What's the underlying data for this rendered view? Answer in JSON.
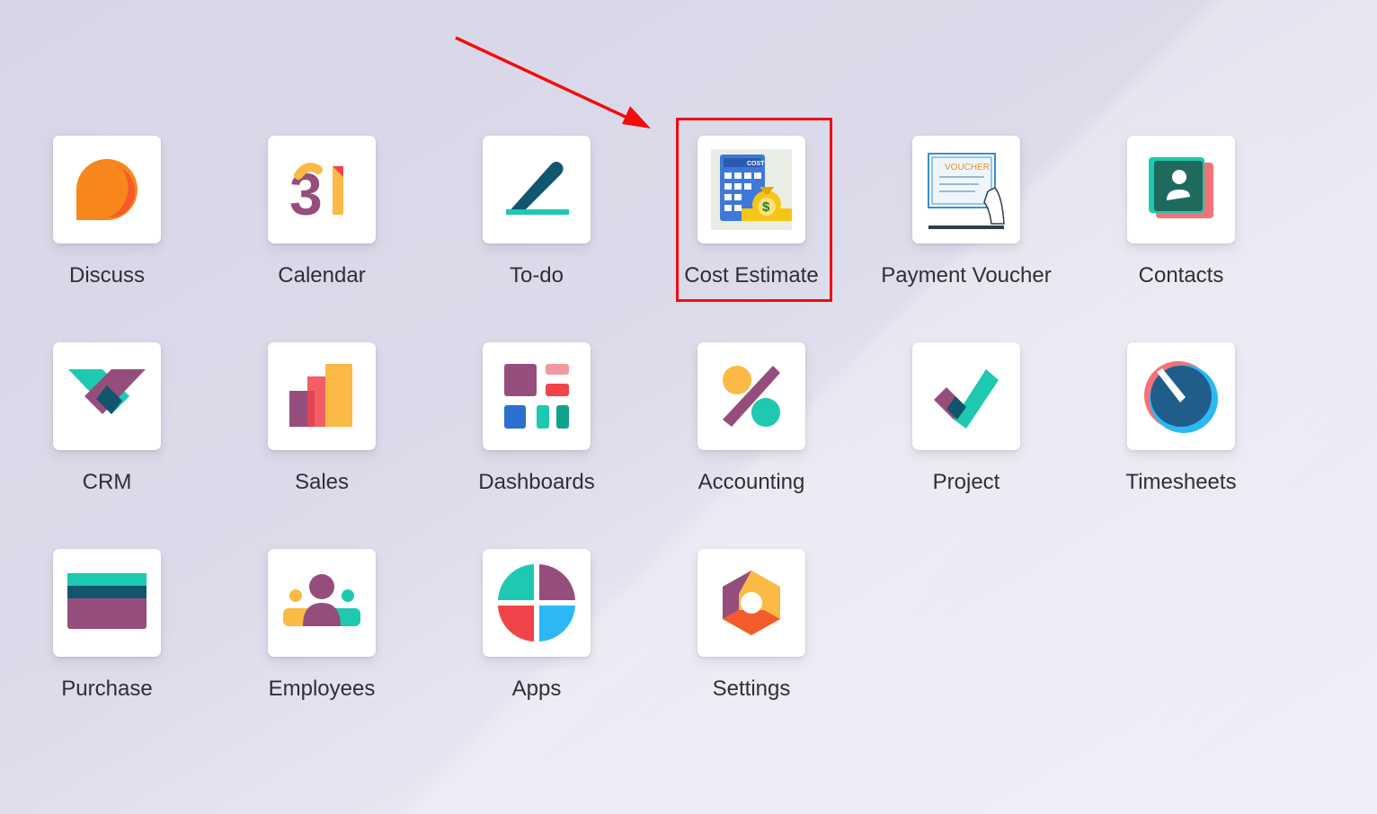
{
  "apps": [
    {
      "label": "Discuss",
      "icon": "discuss-icon"
    },
    {
      "label": "Calendar",
      "icon": "calendar-icon",
      "icon_text": "31"
    },
    {
      "label": "To-do",
      "icon": "todo-icon"
    },
    {
      "label": "Cost Estimate",
      "icon": "cost-estimate-icon",
      "icon_text": "COST"
    },
    {
      "label": "Payment Voucher",
      "icon": "payment-voucher-icon",
      "icon_text": "VOUCHER"
    },
    {
      "label": "Contacts",
      "icon": "contacts-icon"
    },
    {
      "label": "CRM",
      "icon": "crm-icon"
    },
    {
      "label": "Sales",
      "icon": "sales-icon"
    },
    {
      "label": "Dashboards",
      "icon": "dashboards-icon"
    },
    {
      "label": "Accounting",
      "icon": "accounting-icon"
    },
    {
      "label": "Project",
      "icon": "project-icon"
    },
    {
      "label": "Timesheets",
      "icon": "timesheets-icon"
    },
    {
      "label": "Purchase",
      "icon": "purchase-icon"
    },
    {
      "label": "Employees",
      "icon": "employees-icon"
    },
    {
      "label": "Apps",
      "icon": "apps-icon"
    },
    {
      "label": "Settings",
      "icon": "settings-icon"
    }
  ],
  "annotation": {
    "highlighted_app": "Cost Estimate",
    "color": "#f20d0d"
  },
  "colors": {
    "purple": "#954e7c",
    "teal": "#1ec8b1",
    "orange": "#f7871c",
    "red": "#f0434a",
    "yellow": "#fbb945",
    "blue": "#2cb8f4"
  }
}
